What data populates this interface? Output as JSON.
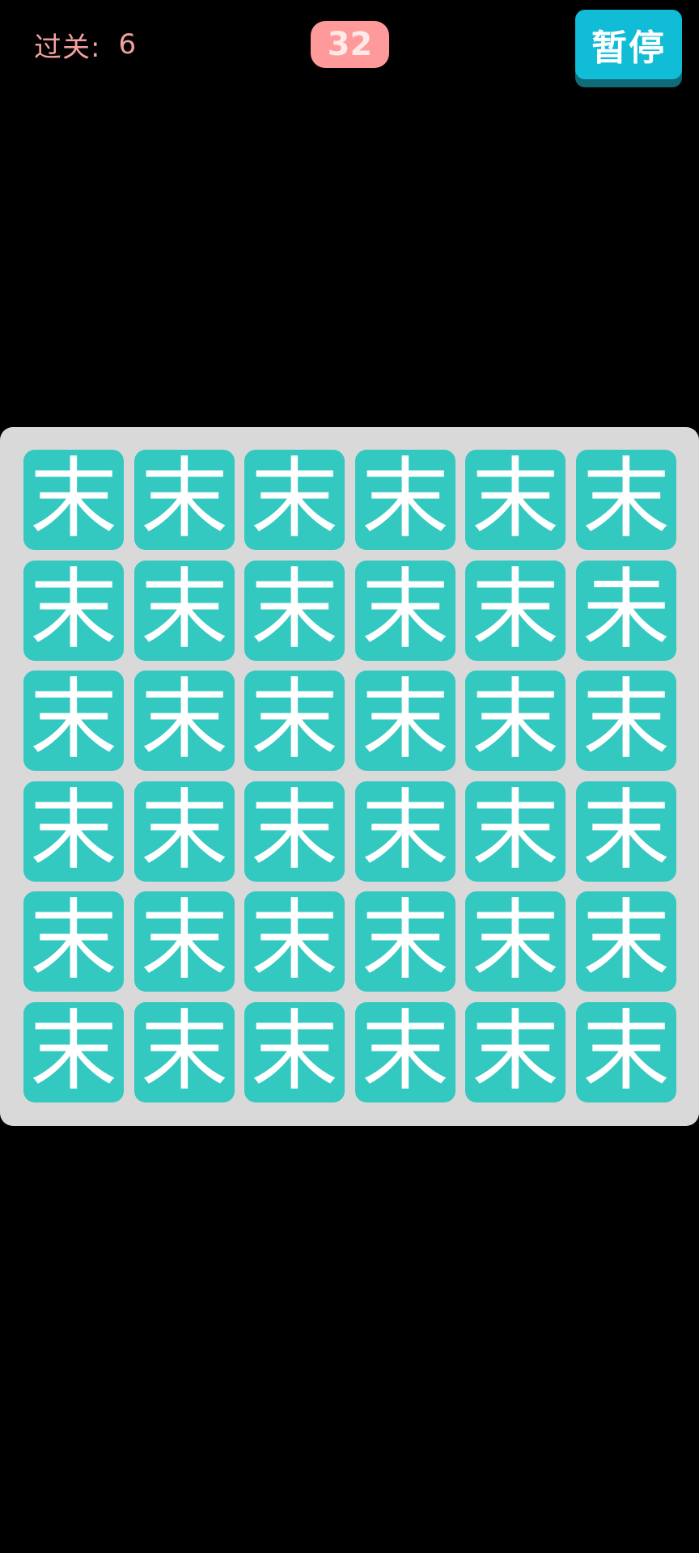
{
  "header": {
    "level_label": "过关:",
    "level_value": "6",
    "timer": "32",
    "pause_label": "暂停"
  },
  "board": {
    "rows": 6,
    "cols": 6,
    "tile_char": "末",
    "odd_tile_char": "未",
    "odd_tile": {
      "row": 2,
      "col": 6
    }
  },
  "colors": {
    "background": "#000000",
    "board": "#d9d9d9",
    "tile": "#33c8c0",
    "tile_text": "#ffffff",
    "timer_bg": "#ff9a9a",
    "pause_bg": "#10bcd6",
    "level_text": "#f4a0a0"
  }
}
